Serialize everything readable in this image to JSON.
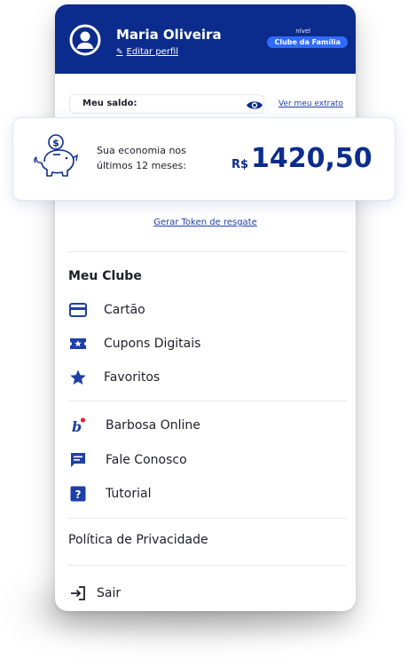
{
  "header": {
    "user_name": "Maria Oliveira",
    "edit_profile": "Editar perfil",
    "level_label": "nível",
    "level_badge": "Clube da Família"
  },
  "balance": {
    "label": "Meu saldo:",
    "statement_link": "Ver meu extrato"
  },
  "economy": {
    "text": "Sua economia nos últimos 12 meses:",
    "currency": "R$",
    "value": "1420,50"
  },
  "token_link": "Gerar Token de resgate",
  "club": {
    "title": "Meu Clube",
    "items": [
      {
        "label": "Cartão",
        "icon": "card-icon"
      },
      {
        "label": "Cupons Digitais",
        "icon": "ticket-icon"
      },
      {
        "label": "Favoritos",
        "icon": "star-icon"
      }
    ]
  },
  "services": {
    "items": [
      {
        "label": "Barbosa Online",
        "icon": "barbosa-logo-icon"
      },
      {
        "label": "Fale Conosco",
        "icon": "chat-icon"
      },
      {
        "label": "Tutorial",
        "icon": "help-icon"
      }
    ]
  },
  "privacy": "Política de Privacidade",
  "logout": "Sair",
  "colors": {
    "primary": "#0b2c8c",
    "badge": "#2f6bff",
    "link": "#1d3fa8"
  }
}
